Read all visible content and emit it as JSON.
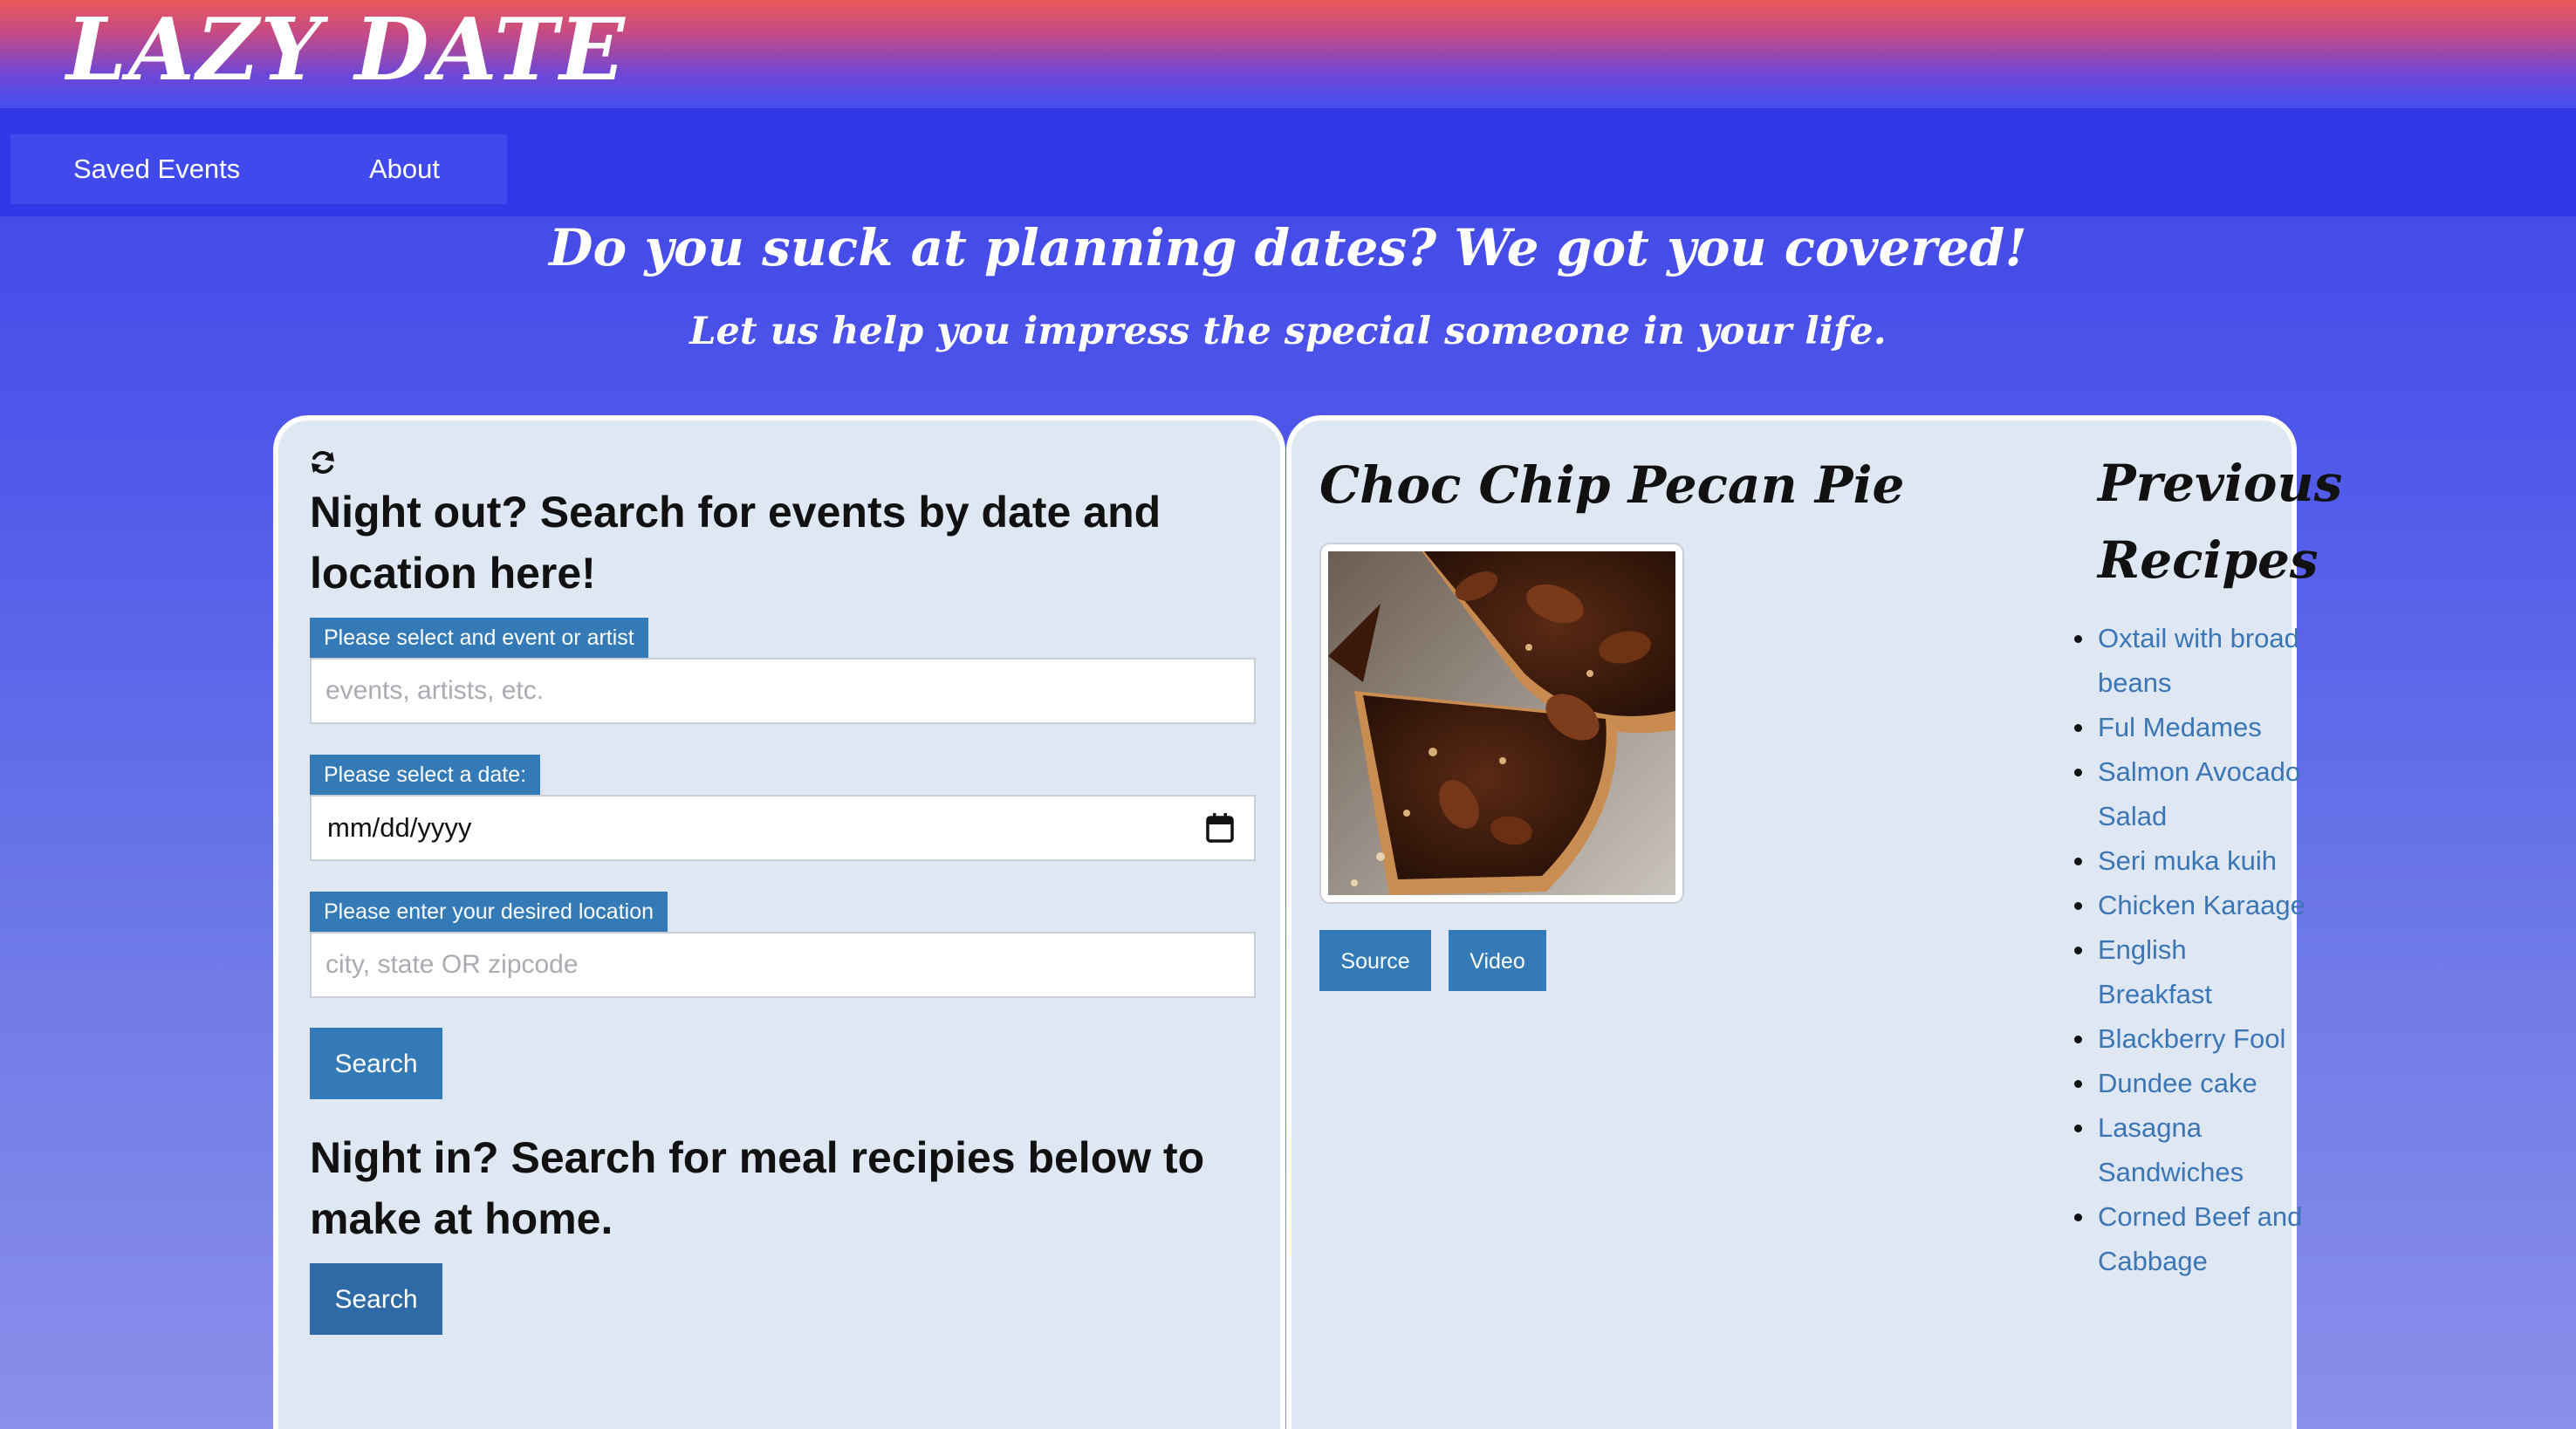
{
  "app": {
    "logo": "LAZY DATE"
  },
  "nav": {
    "items": [
      {
        "label": "Saved Events"
      },
      {
        "label": "About"
      }
    ]
  },
  "hero": {
    "title": "Do you suck at planning dates? We got you covered!",
    "subtitle": "Let us help you impress the special someone in your life."
  },
  "events": {
    "heading": "Night out? Search for events by date and location here!",
    "event_label": "Please select and event or artist",
    "event_placeholder": "events, artists, etc.",
    "date_label": "Please select a date:",
    "date_value": "mm/dd/yyyy",
    "location_label": "Please enter your desired location",
    "location_placeholder": "city, state OR zipcode",
    "search_label": "Search"
  },
  "meals": {
    "heading": "Night in? Search for meal recipies below to make at home.",
    "search_label": "Search"
  },
  "recipe": {
    "title": "Choc Chip Pecan Pie",
    "source_label": "Source",
    "video_label": "Video"
  },
  "previous": {
    "title": "Previous Recipes",
    "items": [
      "Oxtail with broad beans",
      "Ful Medames",
      "Salmon Avocado Salad",
      "Seri muka kuih",
      "Chicken Karaage",
      "English Breakfast",
      "Blackberry Fool",
      "Dundee cake",
      "Lasagna Sandwiches",
      "Corned Beef and Cabbage"
    ]
  },
  "colors": {
    "accent": "#337ab7",
    "navbar": "#3138e9",
    "card": "#dfe7f3",
    "link": "#3a76b6"
  },
  "icons": [
    "refresh-icon",
    "calendar-icon"
  ]
}
